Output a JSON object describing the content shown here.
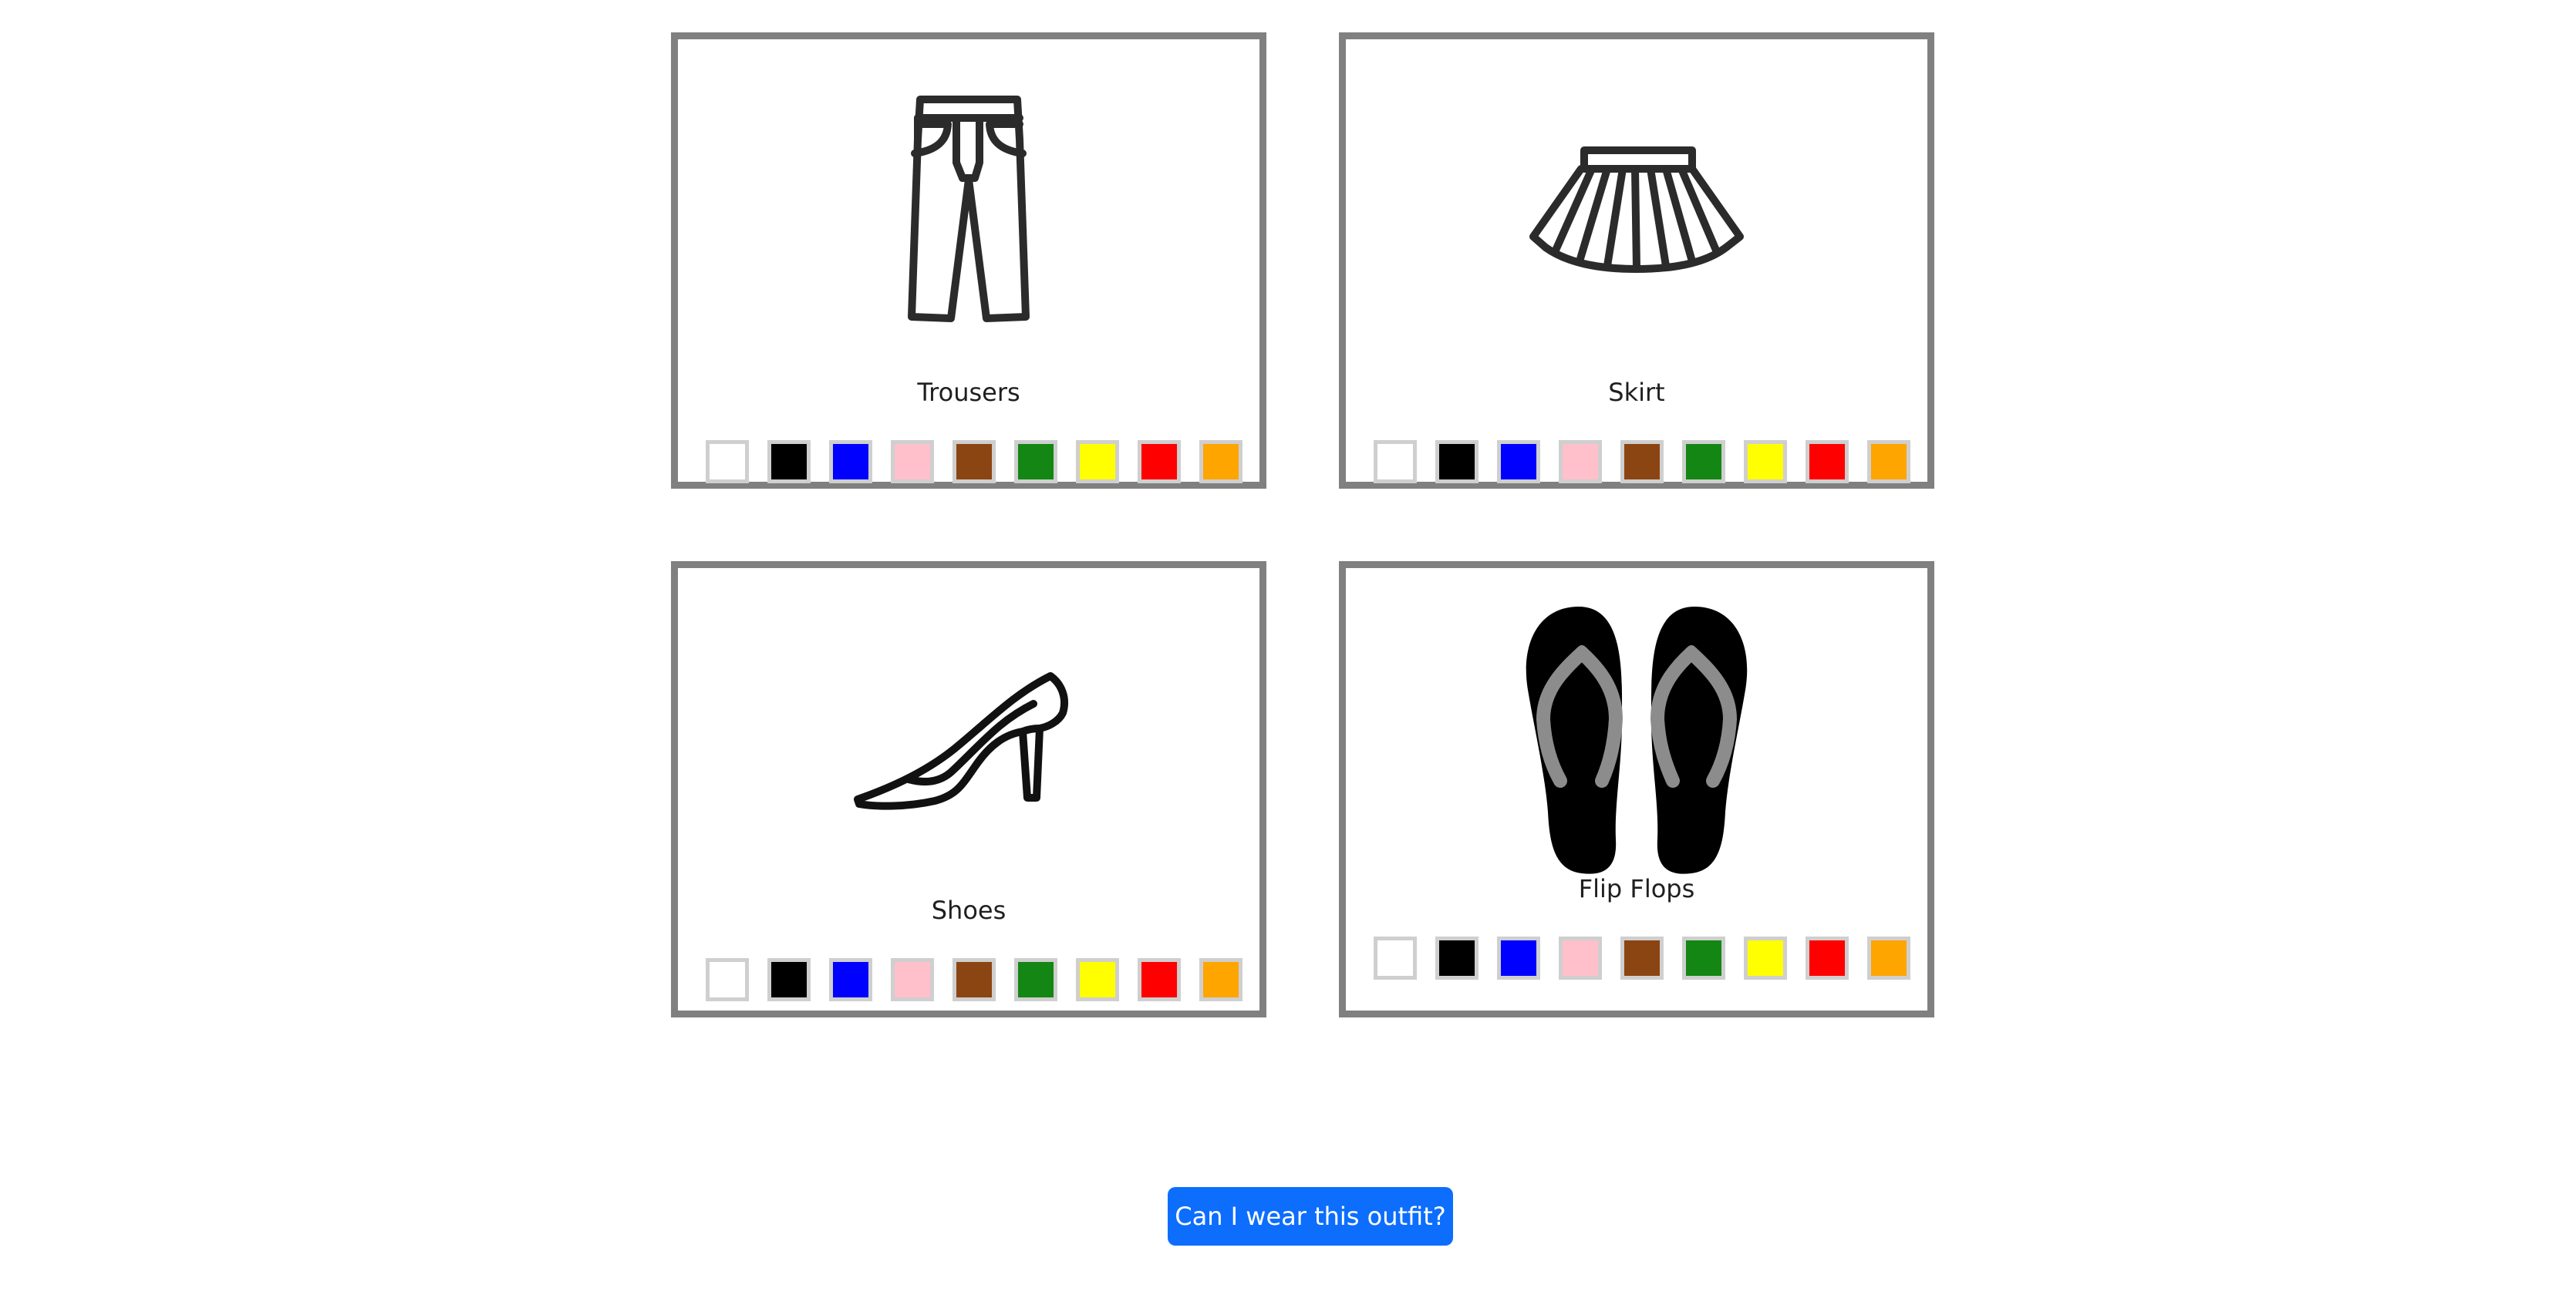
{
  "palette": [
    {
      "name": "white",
      "hex": "#ffffff"
    },
    {
      "name": "black",
      "hex": "#000000"
    },
    {
      "name": "blue",
      "hex": "#0000ff"
    },
    {
      "name": "pink",
      "hex": "#ffc0cb"
    },
    {
      "name": "brown",
      "hex": "#8b4513"
    },
    {
      "name": "green",
      "hex": "#138613"
    },
    {
      "name": "yellow",
      "hex": "#ffff00"
    },
    {
      "name": "red",
      "hex": "#ff0000"
    },
    {
      "name": "orange",
      "hex": "#ffa500"
    }
  ],
  "items": [
    {
      "id": "trousers",
      "label": "Trousers",
      "icon": "trousers-icon"
    },
    {
      "id": "skirt",
      "label": "Skirt",
      "icon": "skirt-icon"
    },
    {
      "id": "shoes",
      "label": "Shoes",
      "icon": "high-heel-shoe-icon"
    },
    {
      "id": "flip-flops",
      "label": "Flip Flops",
      "icon": "flip-flops-icon"
    }
  ],
  "submit_label": "Can I wear this outfit?"
}
